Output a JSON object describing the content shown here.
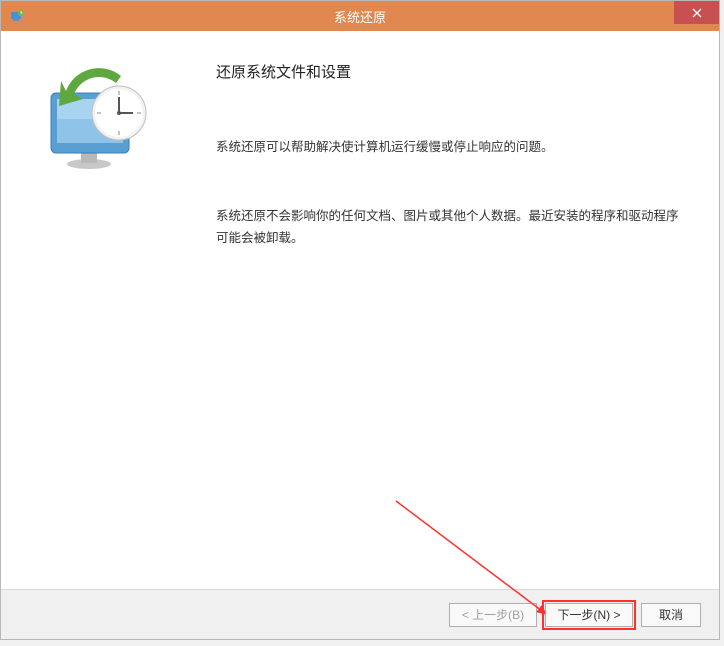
{
  "titlebar": {
    "title": "系统还原"
  },
  "content": {
    "heading": "还原系统文件和设置",
    "paragraph1": "系统还原可以帮助解决使计算机运行缓慢或停止响应的问题。",
    "paragraph2": "系统还原不会影响你的任何文档、图片或其他个人数据。最近安装的程序和驱动程序可能会被卸载。"
  },
  "footer": {
    "back": "< 上一步(B)",
    "next": "下一步(N) >",
    "cancel": "取消"
  }
}
